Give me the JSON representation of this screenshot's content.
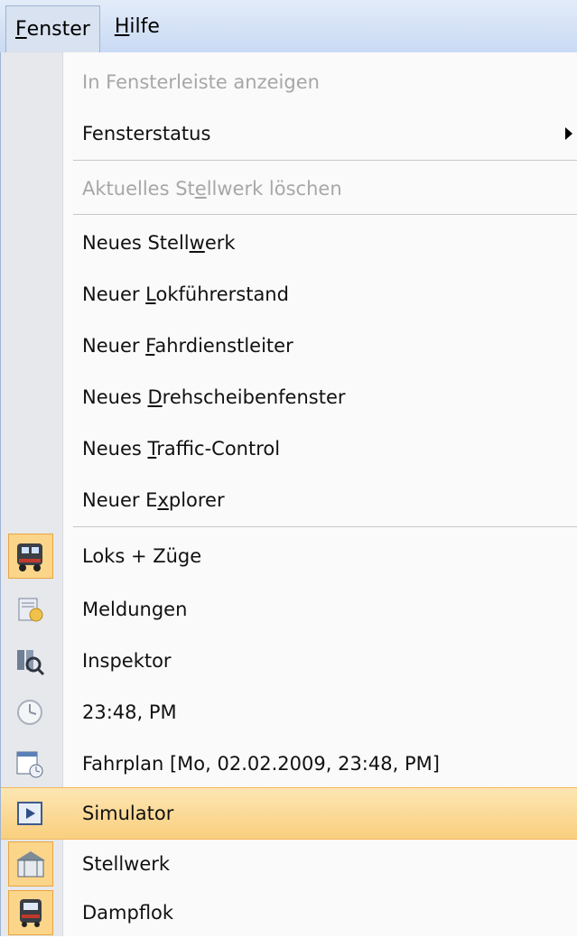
{
  "menubar": {
    "fenster": {
      "prefix": "",
      "mnemonic": "F",
      "rest": "enster"
    },
    "hilfe": {
      "prefix": "",
      "mnemonic": "H",
      "rest": "ilfe"
    }
  },
  "menu": {
    "in_taskbar": "In Fensterleiste anzeigen",
    "fensterstatus": "Fensterstatus",
    "delete": {
      "prefix": "Aktuelles St",
      "mnemonic": "e",
      "rest": "llwerk löschen"
    },
    "neues_stellwerk": {
      "prefix": "Neues Stell",
      "mnemonic": "w",
      "rest": "erk"
    },
    "lokfuehrerstand": {
      "prefix": "Neuer ",
      "mnemonic": "L",
      "rest": "okführerstand"
    },
    "fahrdienstleiter": {
      "prefix": "Neuer ",
      "mnemonic": "F",
      "rest": "ahrdienstleiter"
    },
    "drehscheibe": {
      "prefix": "Neues ",
      "mnemonic": "D",
      "rest": "rehscheibenfenster"
    },
    "traffic": {
      "prefix": "Neues ",
      "mnemonic": "T",
      "rest": "raffic-Control"
    },
    "explorer": {
      "prefix": "Neuer E",
      "mnemonic": "x",
      "rest": "plorer"
    },
    "loks": "Loks + Züge",
    "meldungen": "Meldungen",
    "inspektor": "Inspektor",
    "clock": "23:48, PM",
    "fahrplan": "Fahrplan [Mo, 02.02.2009, 23:48, PM]",
    "simulator": "Simulator",
    "stellwerk": "Stellwerk",
    "dampflok": "Dampflok"
  },
  "icons": {
    "loks": "locomotive-icon",
    "meldungen": "messages-icon",
    "inspektor": "inspector-icon",
    "clock": "clock-icon",
    "fahrplan": "timetable-icon",
    "simulator": "simulator-play-icon",
    "stellwerk": "signalbox-icon",
    "dampflok": "steam-locomotive-icon"
  },
  "colors": {
    "highlight": "#f9cf7e",
    "checked_bg": "#fbd58a",
    "disabled_text": "#a7a7a7",
    "menubar": "#c9daf3"
  }
}
